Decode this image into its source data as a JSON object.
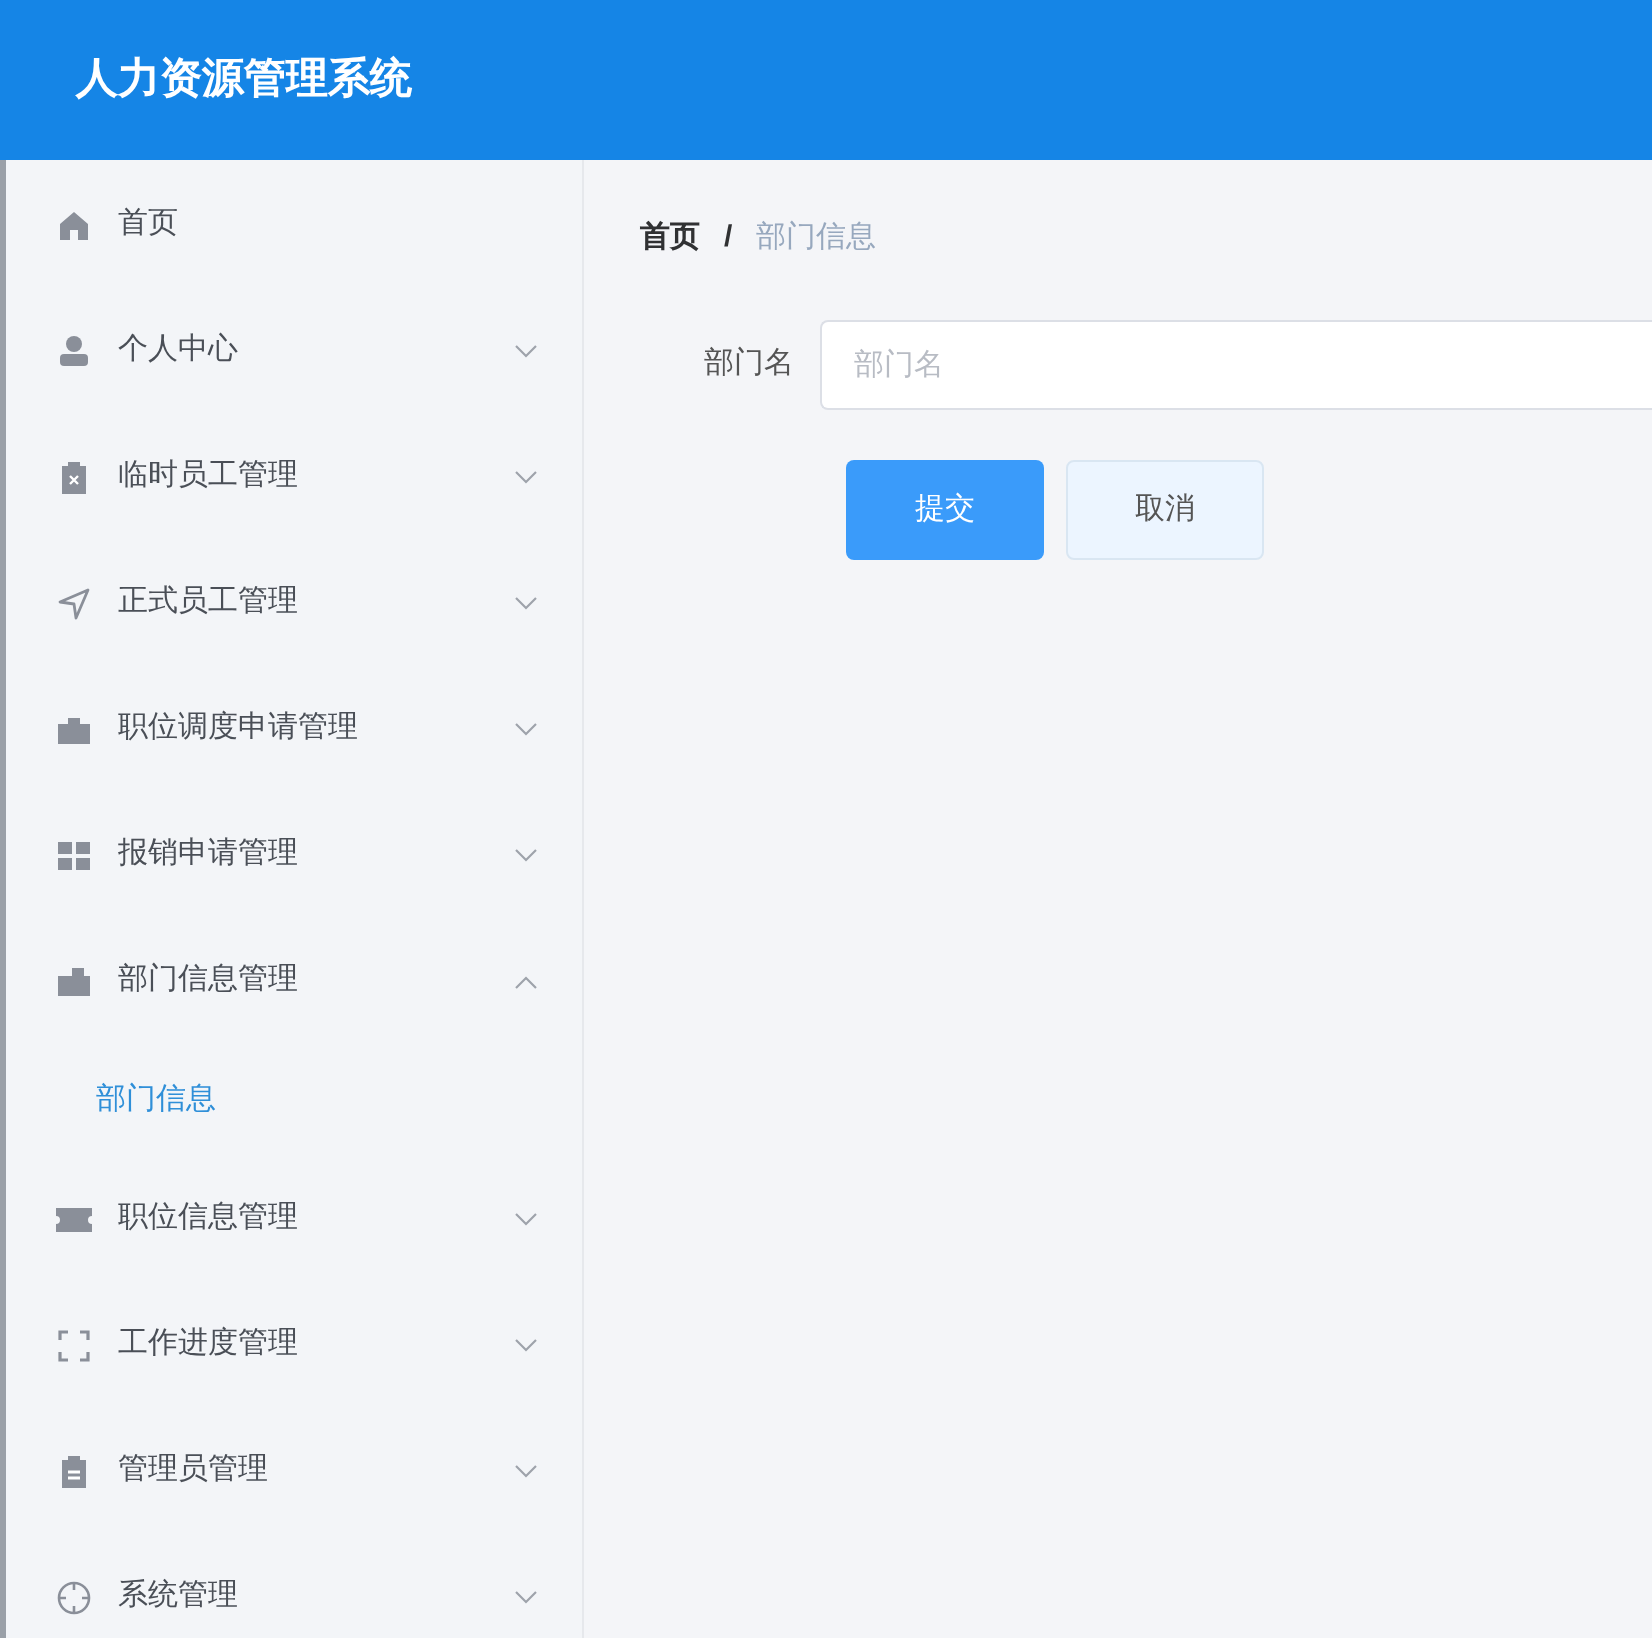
{
  "header": {
    "title": "人力资源管理系统"
  },
  "sidebar": {
    "items": [
      {
        "label": "首页",
        "kind": "link"
      },
      {
        "label": "个人中心",
        "kind": "submenu",
        "expanded": false
      },
      {
        "label": "临时员工管理",
        "kind": "submenu",
        "expanded": false
      },
      {
        "label": "正式员工管理",
        "kind": "submenu",
        "expanded": false
      },
      {
        "label": "职位调度申请管理",
        "kind": "submenu",
        "expanded": false
      },
      {
        "label": "报销申请管理",
        "kind": "submenu",
        "expanded": false
      },
      {
        "label": "部门信息管理",
        "kind": "submenu",
        "expanded": true,
        "children": [
          {
            "label": "部门信息",
            "selected": true
          }
        ]
      },
      {
        "label": "职位信息管理",
        "kind": "submenu",
        "expanded": false
      },
      {
        "label": "工作进度管理",
        "kind": "submenu",
        "expanded": false
      },
      {
        "label": "管理员管理",
        "kind": "submenu",
        "expanded": false
      },
      {
        "label": "系统管理",
        "kind": "submenu",
        "expanded": false
      }
    ]
  },
  "breadcrumb": [
    {
      "label": "首页"
    },
    {
      "label": "部门信息"
    }
  ],
  "breadcrumb_separator": "/",
  "form": {
    "field": {
      "label": "部门名",
      "placeholder": "部门名"
    },
    "buttons": [
      {
        "label": "提交",
        "kind": "primary"
      },
      {
        "label": "取消",
        "kind": "secondary"
      }
    ]
  }
}
